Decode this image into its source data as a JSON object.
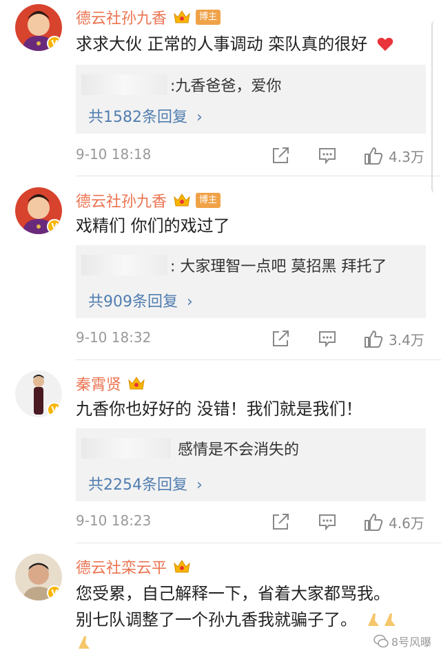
{
  "colors": {
    "name": "#eb7350",
    "link": "#507daf",
    "owner_badge": "#f0a248",
    "heart": "#e8343a"
  },
  "comments": [
    {
      "username": "德云社孙九香",
      "owner_badge": "博主",
      "text": "求求大伙 正常的人事调动 栾队真的很好",
      "reply_text": ":九香爸爸，爱你",
      "reply_count": "共1582条回复",
      "chevron": "›",
      "time": "9-10 18:18",
      "likes": "4.3万"
    },
    {
      "username": "德云社孙九香",
      "owner_badge": "博主",
      "text": "戏精们 你们的戏过了",
      "reply_text": ": 大家理智一点吧 莫招黑 拜托了",
      "reply_count": "共909条回复",
      "chevron": "›",
      "time": "9-10 18:32",
      "likes": "3.4万"
    },
    {
      "username": "秦霄贤",
      "text": "九香你也好好的  没错！我们就是我们！",
      "reply_text": "感情是不会消失的",
      "reply_count": "共2254条回复",
      "chevron": "›",
      "time": "9-10 18:23",
      "likes": "4.6万"
    },
    {
      "username": "德云社栾云平",
      "text_line1": "您受累，自己解释一下，省着大家都骂我。",
      "text_line2": "别七队调整了一个孙九香我就骗子了。"
    }
  ],
  "watermark": "8号风曝"
}
